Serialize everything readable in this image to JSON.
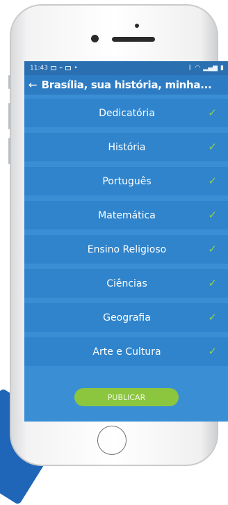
{
  "status_bar": {
    "time": "11:43",
    "left_icons": [
      "gallery-icon",
      "missed-call-icon",
      "message-icon"
    ],
    "right_icons": [
      "bluetooth-icon",
      "wifi-icon",
      "signal-icon",
      "battery-icon"
    ]
  },
  "app_bar": {
    "back_icon": "←",
    "title": "Brasília, sua história, minha..."
  },
  "items": [
    {
      "label": "Dedicatória",
      "check": "✓"
    },
    {
      "label": "História",
      "check": "✓"
    },
    {
      "label": "Português",
      "check": "✓"
    },
    {
      "label": "Matemática",
      "check": "✓"
    },
    {
      "label": "Ensino Religioso",
      "check": "✓"
    },
    {
      "label": "Ciências",
      "check": "✓"
    },
    {
      "label": "Geografia",
      "check": "✓"
    },
    {
      "label": "Arte e Cultura",
      "check": "✓"
    }
  ],
  "publish_button": {
    "label": "PUBLICAR"
  },
  "colors": {
    "accent": "#2f84cc",
    "app_bar": "#2d7cc3",
    "check": "#8fd14f",
    "publish": "#8cc63f"
  }
}
